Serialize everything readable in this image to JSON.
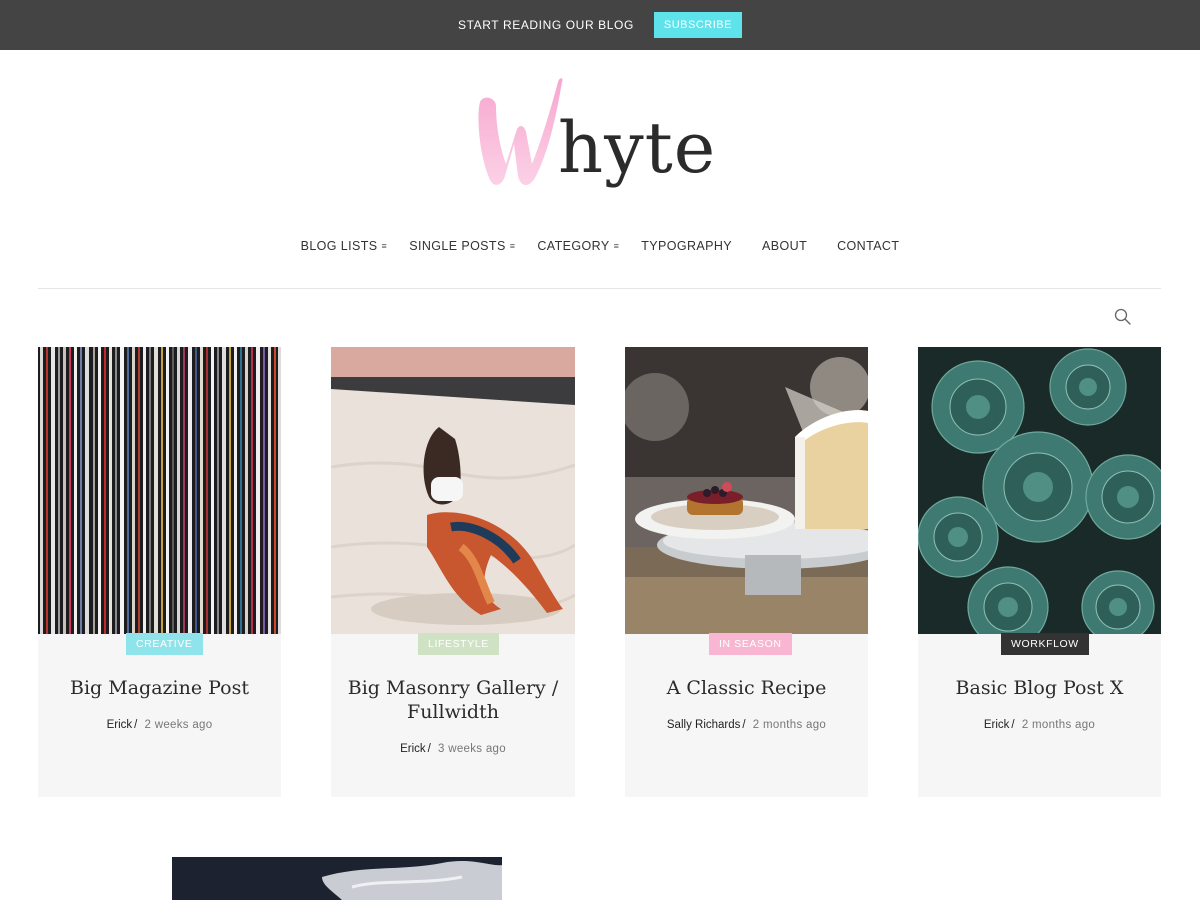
{
  "topbar": {
    "text": "START READING OUR BLOG",
    "subscribe_label": "SUBSCRIBE",
    "bg_color": "#444444",
    "button_color": "#5ee3ea"
  },
  "logo": {
    "text": "hyte"
  },
  "nav": {
    "items": [
      {
        "label": "BLOG LISTS",
        "has_dropdown": true
      },
      {
        "label": "SINGLE POSTS",
        "has_dropdown": true
      },
      {
        "label": "CATEGORY",
        "has_dropdown": true
      },
      {
        "label": "TYPOGRAPHY",
        "has_dropdown": false
      },
      {
        "label": "ABOUT",
        "has_dropdown": false
      },
      {
        "label": "CONTACT",
        "has_dropdown": false
      }
    ],
    "dropdown_icon": "menu-lines-icon"
  },
  "search": {
    "icon": "search-icon"
  },
  "posts": [
    {
      "category": "CREATIVE",
      "category_color": "#8fe3ea",
      "title": "Big Magazine Post",
      "author": "Erick",
      "time": "2 weeks ago"
    },
    {
      "category": "LIFESTYLE",
      "category_color": "#cfe2c4",
      "title": "Big Masonry Gallery / Fullwidth",
      "author": "Erick",
      "time": "3 weeks ago"
    },
    {
      "category": "IN SEASON",
      "category_color": "#f9b6d2",
      "title": "A Classic Recipe",
      "author": "Sally Richards",
      "time": "2 months ago"
    },
    {
      "category": "WORKFLOW",
      "category_color": "#333333",
      "title": "Basic Blog Post X",
      "author": "Erick",
      "time": "2 months ago"
    }
  ]
}
